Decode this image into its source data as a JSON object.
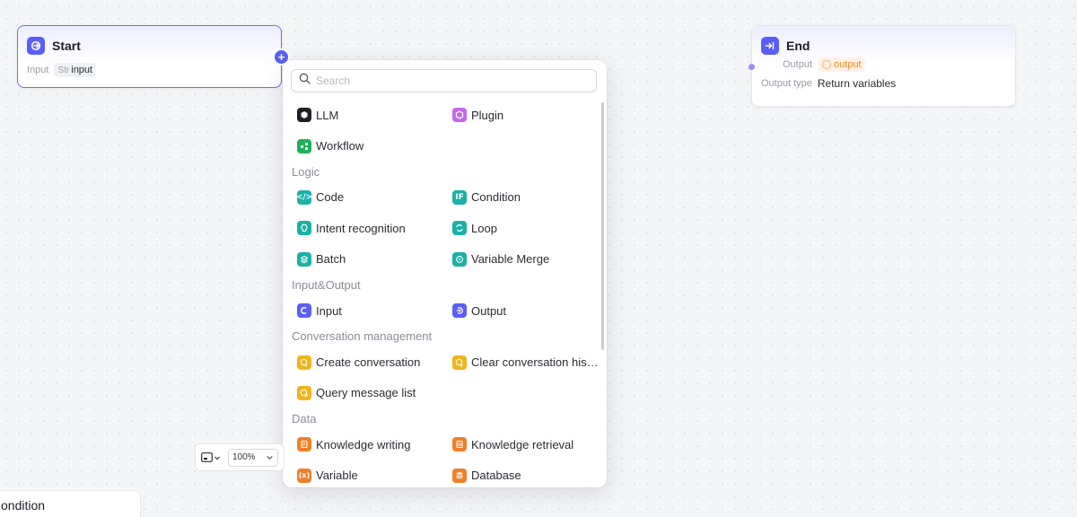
{
  "start_node": {
    "title": "Start",
    "input_label": "Input",
    "input_type": "Str",
    "input_name": "input"
  },
  "end_node": {
    "title": "End",
    "output_label": "Output",
    "output_name": "output",
    "output_type_label": "Output type",
    "output_type_value": "Return variables"
  },
  "add_node_menu": {
    "search_placeholder": "Search",
    "top_items": [
      {
        "label": "LLM",
        "icon": "llm-icon",
        "color": "#1d1f26"
      },
      {
        "label": "Plugin",
        "icon": "plugin-icon",
        "color": "#c467f0"
      },
      {
        "label": "Workflow",
        "icon": "workflow-icon",
        "color": "#1fae58"
      }
    ],
    "sections": [
      {
        "title": "Logic",
        "items": [
          {
            "label": "Code",
            "icon": "code-icon",
            "color": "#1cb0a8"
          },
          {
            "label": "Condition",
            "icon": "condition-icon",
            "color": "#1cb0a8"
          },
          {
            "label": "Intent recognition",
            "icon": "intent-icon",
            "color": "#1cb0a8"
          },
          {
            "label": "Loop",
            "icon": "loop-icon",
            "color": "#1cb0a8"
          },
          {
            "label": "Batch",
            "icon": "batch-icon",
            "color": "#1cb0a8"
          },
          {
            "label": "Variable Merge",
            "icon": "variable-merge-icon",
            "color": "#1cb0a8"
          }
        ]
      },
      {
        "title": "Input&Output",
        "items": [
          {
            "label": "Input",
            "icon": "input-icon",
            "color": "#5b5ef5"
          },
          {
            "label": "Output",
            "icon": "output-icon",
            "color": "#5b5ef5"
          }
        ]
      },
      {
        "title": "Conversation management",
        "items": [
          {
            "label": "Create conversation",
            "icon": "create-conversation-icon",
            "color": "#f0b41c"
          },
          {
            "label": "Clear conversation his…",
            "icon": "clear-conversation-icon",
            "color": "#f0b41c"
          },
          {
            "label": "Query message list",
            "icon": "query-message-icon",
            "color": "#f0b41c"
          }
        ]
      },
      {
        "title": "Data",
        "items": [
          {
            "label": "Knowledge writing",
            "icon": "knowledge-writing-icon",
            "color": "#f07f2a"
          },
          {
            "label": "Knowledge retrieval",
            "icon": "knowledge-retrieval-icon",
            "color": "#f07f2a"
          },
          {
            "label": "Variable",
            "icon": "variable-icon",
            "color": "#f07f2a"
          },
          {
            "label": "Database",
            "icon": "database-icon",
            "color": "#f07f2a"
          }
        ]
      }
    ]
  },
  "zoom": {
    "value": "100%"
  },
  "partial_node": {
    "title": "ondition"
  },
  "colors": {
    "accent": "#5b5ef5"
  }
}
